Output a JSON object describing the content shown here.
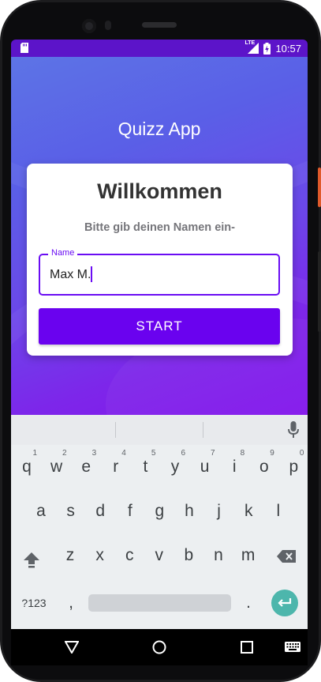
{
  "status_bar": {
    "network": "LTE",
    "time": "10:57",
    "icons": [
      "sd-card-icon",
      "signal-icon",
      "battery-charging-icon"
    ]
  },
  "app": {
    "title": "Quizz App",
    "card": {
      "title": "Willkommen",
      "subtitle": "Bitte gib deinen Namen ein-",
      "name_field": {
        "label": "Name",
        "value": "Max M."
      },
      "start_button": "START"
    }
  },
  "keyboard": {
    "row1": [
      {
        "key": "q",
        "hint": "1"
      },
      {
        "key": "w",
        "hint": "2"
      },
      {
        "key": "e",
        "hint": "3"
      },
      {
        "key": "r",
        "hint": "4"
      },
      {
        "key": "t",
        "hint": "5"
      },
      {
        "key": "y",
        "hint": "6"
      },
      {
        "key": "u",
        "hint": "7"
      },
      {
        "key": "i",
        "hint": "8"
      },
      {
        "key": "o",
        "hint": "9"
      },
      {
        "key": "p",
        "hint": "0"
      }
    ],
    "row2": [
      "a",
      "s",
      "d",
      "f",
      "g",
      "h",
      "j",
      "k",
      "l"
    ],
    "row3": [
      "z",
      "x",
      "c",
      "v",
      "b",
      "n",
      "m"
    ],
    "symbols_key": "?123",
    "comma_key": ",",
    "period_key": ".",
    "icons": [
      "mic-icon",
      "shift-icon",
      "backspace-icon",
      "enter-icon"
    ]
  },
  "nav_bar": {
    "icons": [
      "back-icon",
      "home-icon",
      "recents-icon",
      "keyboard-switch-icon"
    ]
  },
  "colors": {
    "status_bar": "#5c14c9",
    "accent": "#6a0df3",
    "button": "#6a02ef",
    "enter_key": "#4db6ac"
  }
}
